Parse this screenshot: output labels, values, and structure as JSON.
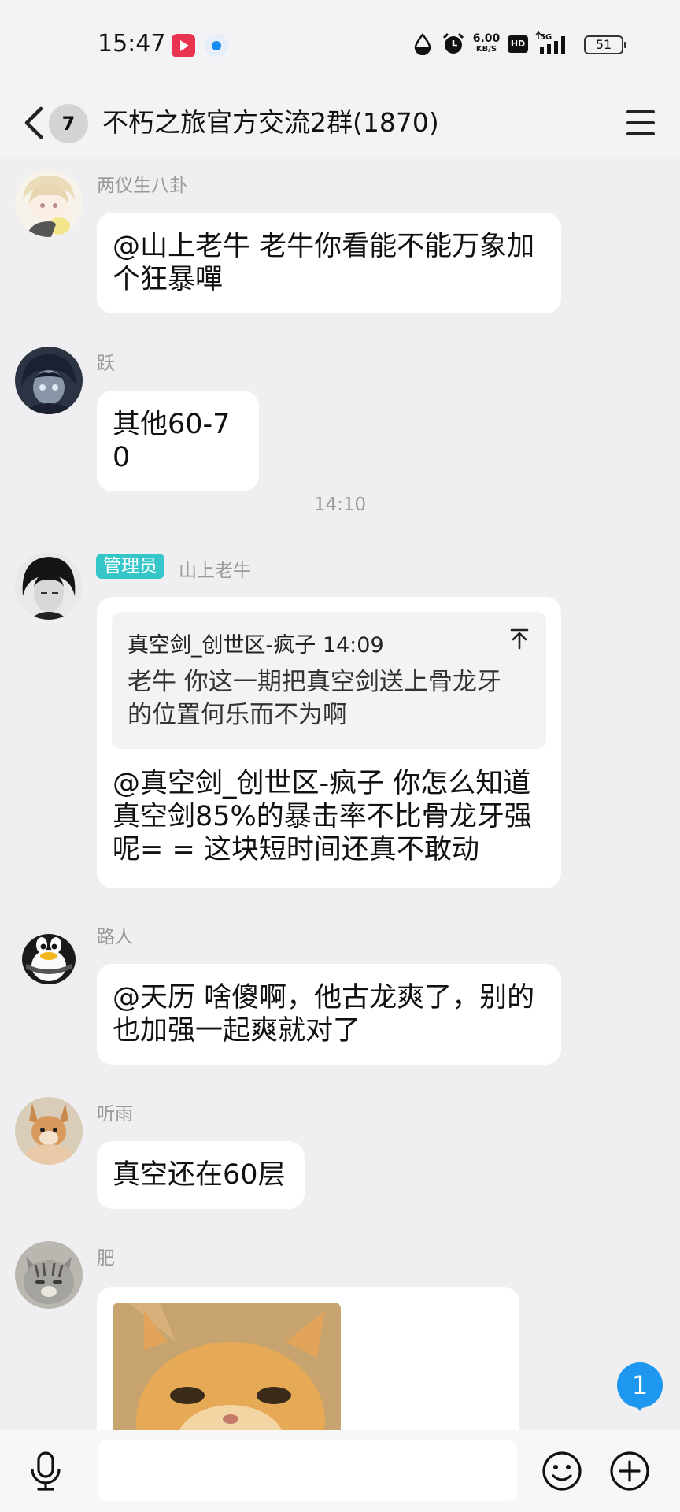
{
  "status_bar": {
    "time": "15:47",
    "net_speed_value": "6.00",
    "net_speed_unit": "KB/S",
    "hd_label": "HD",
    "network_label": "5G",
    "battery": "51"
  },
  "header": {
    "unread_count": "7",
    "title": "不朽之旅官方交流2群(1870)"
  },
  "messages": [
    {
      "sender": "两仪生八卦",
      "text": "@山上老牛 老牛你看能不能万象加个狂暴嘽"
    },
    {
      "sender": "跃",
      "text": "其他60-70"
    },
    {
      "time_divider": "14:10"
    },
    {
      "sender": "山上老牛",
      "role_badge": "管理员",
      "quote": {
        "author_time": "真空剑_创世区-疯子 14:09",
        "text": "老牛 你这一期把真空剑送上骨龙牙的位置何乐而不为啊"
      },
      "text": "@真空剑_创世区-疯子 你怎么知道真空剑85%的暴击率不比骨龙牙强呢= =  这块短时间还真不敢动"
    },
    {
      "sender": "路人",
      "text": "@天历 啥傻啊，他古龙爽了，别的也加强一起爽就对了"
    },
    {
      "sender": "听雨",
      "text": "真空还在60层"
    },
    {
      "sender": "肥",
      "image": "cat-photo"
    }
  ],
  "floating_unread": "1",
  "input": {
    "value": "",
    "placeholder": ""
  },
  "icons": {
    "back": "back-arrow-icon",
    "menu": "menu-icon",
    "voice": "microphone-icon",
    "emoji": "smiley-icon",
    "plus": "plus-icon"
  },
  "colors": {
    "admin_badge": "#34c6c9",
    "unread_blue": "#1d97ef",
    "bubble": "#ffffff",
    "background": "#efeff1"
  }
}
